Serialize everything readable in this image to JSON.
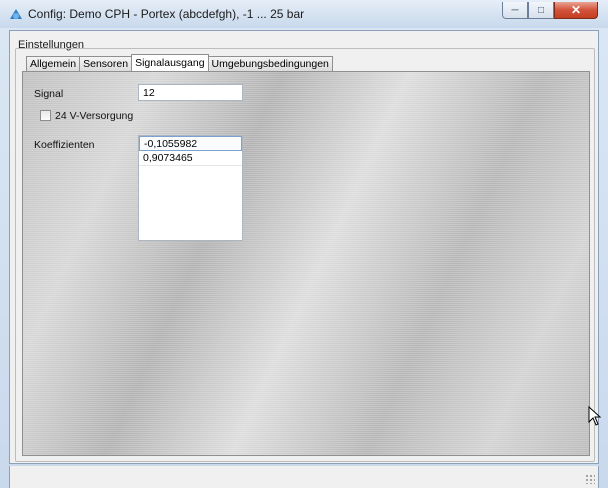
{
  "window": {
    "title": "Config: Demo CPH - Portex (abcdefgh), -1 ... 25 bar",
    "buttons": {
      "minimize": "minimize-icon",
      "maximize": "maximize-icon",
      "close": "close-icon"
    }
  },
  "group": {
    "label": "Einstellungen"
  },
  "tabs": [
    {
      "label": "Allgemein",
      "active": false
    },
    {
      "label": "Sensoren",
      "active": false
    },
    {
      "label": "Signalausgang",
      "active": true
    },
    {
      "label": "Umgebungsbedingungen",
      "active": false
    }
  ],
  "signal": {
    "label": "Signal",
    "value": "12"
  },
  "supply": {
    "label": "24 V-Versorgung",
    "checked": false
  },
  "coefficients": {
    "label": "Koeffizienten",
    "items": [
      "-0,1055982",
      "0,9073465"
    ]
  },
  "colors": {
    "titlebar": "#d3e1f0",
    "close_button": "#c43e22",
    "panel": "#c9c9c9"
  }
}
